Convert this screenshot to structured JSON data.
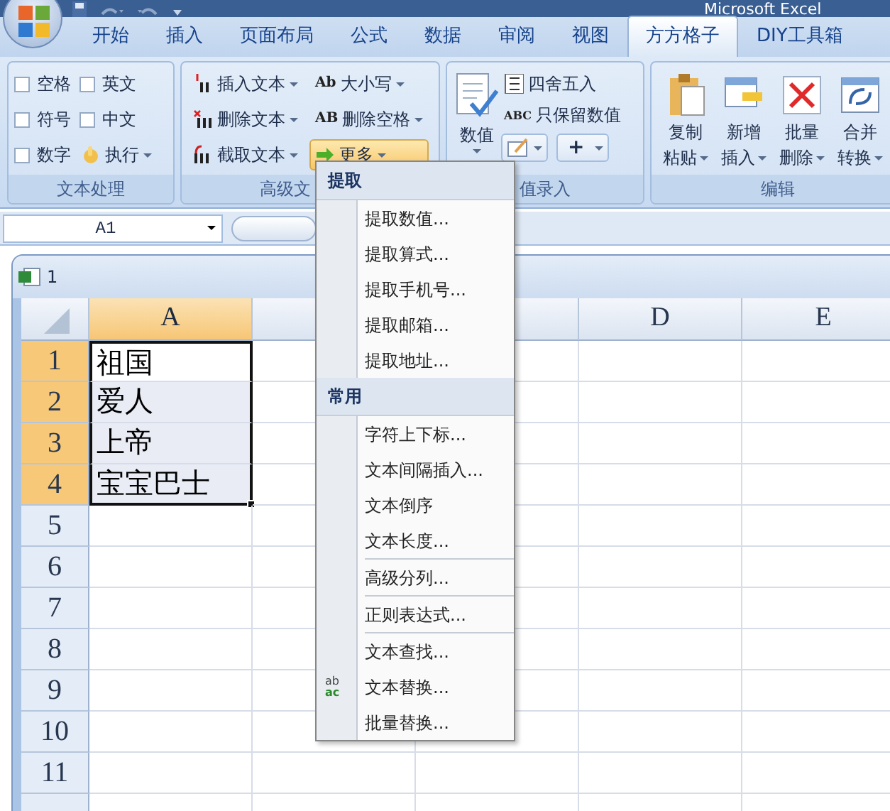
{
  "window": {
    "title": "Microsoft Excel"
  },
  "ribbon_tabs": [
    {
      "label": "开始",
      "selected": false
    },
    {
      "label": "插入",
      "selected": false
    },
    {
      "label": "页面布局",
      "selected": false
    },
    {
      "label": "公式",
      "selected": false
    },
    {
      "label": "数据",
      "selected": false
    },
    {
      "label": "审阅",
      "selected": false
    },
    {
      "label": "视图",
      "selected": false
    },
    {
      "label": "方方格子",
      "selected": true
    },
    {
      "label": "DIY工具箱",
      "selected": false
    }
  ],
  "text_group": {
    "label": "文本处理",
    "checkboxes": [
      {
        "label": "空格",
        "checked": false
      },
      {
        "label": "英文",
        "checked": false
      },
      {
        "label": "符号",
        "checked": false
      },
      {
        "label": "中文",
        "checked": false
      },
      {
        "label": "数字",
        "checked": false
      }
    ],
    "run_button": {
      "label": "执行"
    }
  },
  "advanced_group": {
    "label": "高级文",
    "buttons": [
      {
        "label": "插入文本",
        "kind": "insert"
      },
      {
        "label": "大小写",
        "kind": "case",
        "icon_text": "Ab"
      },
      {
        "label": "删除文本",
        "kind": "delete"
      },
      {
        "label": "删除空格",
        "kind": "trim",
        "icon_text": "AB"
      },
      {
        "label": "截取文本",
        "kind": "cut"
      },
      {
        "label": "更多",
        "kind": "more",
        "active": true
      }
    ]
  },
  "number_group": {
    "label": "值录入",
    "big_button": {
      "label": "数值"
    },
    "buttons": [
      {
        "label": "四舍五入",
        "kind": "round"
      },
      {
        "label": "只保留数值",
        "kind": "values",
        "icon_text": "ABC"
      }
    ],
    "small_buttons": [
      {
        "kind": "edit"
      },
      {
        "kind": "text",
        "label": "+"
      }
    ]
  },
  "edit_group": {
    "label": "编辑",
    "buttons": [
      {
        "line1": "复制",
        "line2": "粘贴",
        "kind": "paste"
      },
      {
        "line1": "新增",
        "line2": "插入",
        "kind": "insert"
      },
      {
        "line1": "批量",
        "line2": "删除",
        "kind": "delete"
      },
      {
        "line1": "合并",
        "line2": "转换",
        "kind": "merge"
      }
    ]
  },
  "name_box": {
    "value": "A1"
  },
  "workbook": {
    "title": "1",
    "columns": [
      {
        "label": "A",
        "selected": true
      },
      {
        "selected": false
      },
      {
        "selected": false
      },
      {
        "label": "D",
        "selected": false
      },
      {
        "label": "E",
        "selected": false
      }
    ],
    "rows": [
      {
        "label": "1",
        "selected": true,
        "cells": [
          {
            "text": "祖国",
            "active": true
          }
        ]
      },
      {
        "label": "2",
        "selected": true,
        "cells": [
          {
            "text": "爱人",
            "active": false
          }
        ]
      },
      {
        "label": "3",
        "selected": true,
        "cells": [
          {
            "text": "上帝",
            "active": false
          }
        ]
      },
      {
        "label": "4",
        "selected": true,
        "cells": [
          {
            "text": "宝宝巴士",
            "active": false
          }
        ]
      },
      {
        "label": "5",
        "selected": false,
        "cells": []
      },
      {
        "label": "6",
        "selected": false,
        "cells": []
      },
      {
        "label": "7",
        "selected": false,
        "cells": []
      },
      {
        "label": "8",
        "selected": false,
        "cells": []
      },
      {
        "label": "9",
        "selected": false,
        "cells": []
      },
      {
        "label": "10",
        "selected": false,
        "cells": []
      },
      {
        "label": "11",
        "selected": false,
        "cells": []
      }
    ]
  },
  "menu": {
    "sections": [
      {
        "header": "提取",
        "items": [
          {
            "label": "提取数值...",
            "kind": "plain",
            "separator_before": false
          },
          {
            "label": "提取算式...",
            "kind": "plain",
            "separator_before": false
          },
          {
            "label": "提取手机号...",
            "kind": "plain",
            "separator_before": false
          },
          {
            "label": "提取邮箱...",
            "kind": "plain",
            "separator_before": false
          },
          {
            "label": "提取地址...",
            "kind": "plain",
            "separator_before": false
          }
        ]
      },
      {
        "header": "常用",
        "items": [
          {
            "label": "字符上下标...",
            "kind": "plain",
            "separator_before": false
          },
          {
            "label": "文本间隔插入...",
            "kind": "plain",
            "separator_before": false
          },
          {
            "label": "文本倒序",
            "kind": "plain",
            "separator_before": false
          },
          {
            "label": "文本长度...",
            "kind": "plain",
            "separator_before": false
          },
          {
            "label": "高级分列...",
            "kind": "plain",
            "separator_before": true
          },
          {
            "label": "正则表达式...",
            "kind": "plain",
            "separator_before": true
          },
          {
            "label": "文本查找...",
            "kind": "plain",
            "separator_before": true
          },
          {
            "label": "文本替换...",
            "kind": "replace",
            "icon_text": [
              "ab",
              "ac"
            ],
            "separator_before": false
          },
          {
            "label": "批量替换...",
            "kind": "plain",
            "separator_before": false
          }
        ]
      }
    ]
  }
}
